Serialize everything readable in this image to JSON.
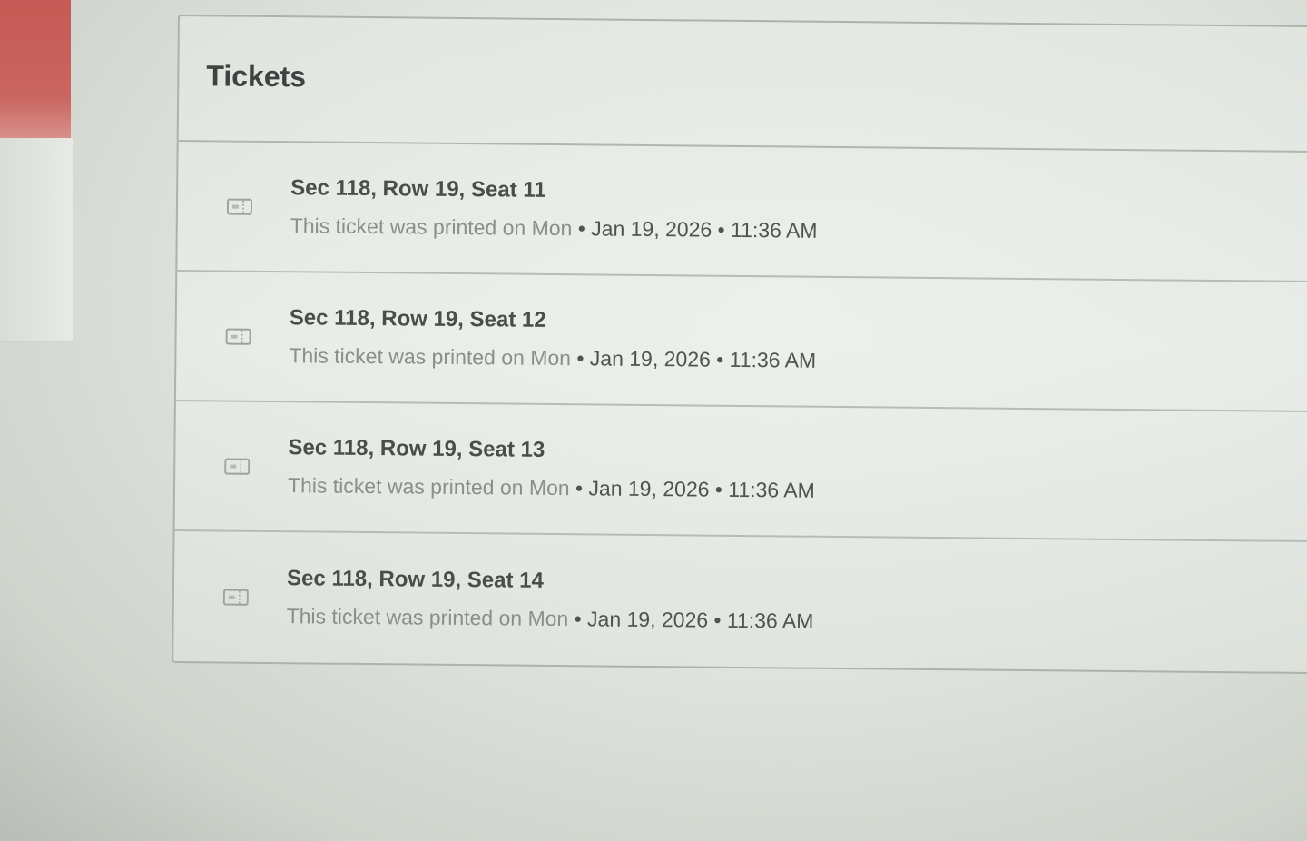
{
  "card": {
    "title": "Tickets"
  },
  "tickets": [
    {
      "seat": "Sec 118, Row 19, Seat 11",
      "printed_prefix": "This ticket was printed on Mon",
      "printed_date": " • Jan 19, 2026 • 11:36 AM"
    },
    {
      "seat": "Sec 118, Row 19, Seat 12",
      "printed_prefix": "This ticket was printed on Mon",
      "printed_date": " • Jan 19, 2026 • 11:36 AM"
    },
    {
      "seat": "Sec 118, Row 19, Seat 13",
      "printed_prefix": "This ticket was printed on Mon",
      "printed_date": " • Jan 19, 2026 • 11:36 AM"
    },
    {
      "seat": "Sec 118, Row 19, Seat 14",
      "printed_prefix": "This ticket was printed on Mon",
      "printed_date": " • Jan 19, 2026 • 11:36 AM"
    }
  ],
  "icons": {
    "ticket": "ticket-icon"
  },
  "colors": {
    "sidebar_accent": "#c75a55",
    "border": "#aeb2ac",
    "title_text": "#3e4240",
    "muted_text": "#8a8f8b"
  }
}
